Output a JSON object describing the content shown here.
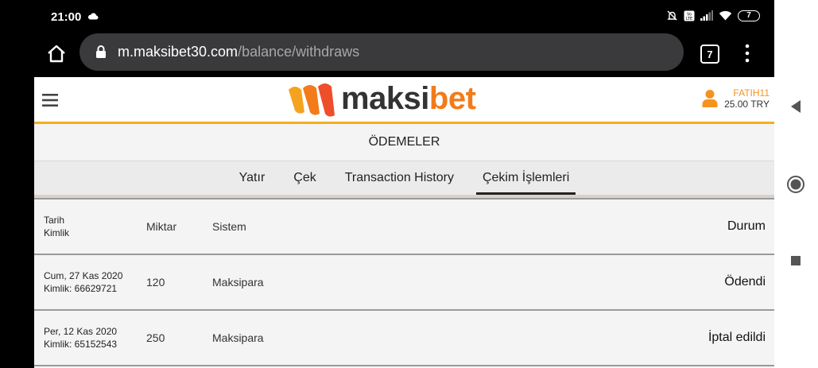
{
  "status_bar": {
    "time": "21:00",
    "battery": "7"
  },
  "browser": {
    "domain": "m.maksibet30.com",
    "path": "/balance/withdraws",
    "tab_count": "7"
  },
  "site": {
    "logo_main": "maksi",
    "logo_accent": "bet",
    "user": {
      "name": "FATIH11",
      "balance": "25.00 TRY"
    },
    "accent_color": "#f2b01e"
  },
  "section_title": "ÖDEMELER",
  "tabs": [
    {
      "label": "Yatır"
    },
    {
      "label": "Çek"
    },
    {
      "label": "Transaction History"
    },
    {
      "label": "Çekim İşlemleri"
    }
  ],
  "table": {
    "header": {
      "date": "Tarih",
      "id": "Kimlik",
      "amount": "Miktar",
      "system": "Sistem",
      "status": "Durum"
    },
    "rows": [
      {
        "date": "Cum, 27 Kas 2020",
        "id": "Kimlik: 66629721",
        "amount": "120",
        "system": "Maksipara",
        "status": "Ödendi"
      },
      {
        "date": "Per, 12 Kas 2020",
        "id": "Kimlik: 65152543",
        "amount": "250",
        "system": "Maksipara",
        "status": "İptal edildi"
      }
    ]
  }
}
